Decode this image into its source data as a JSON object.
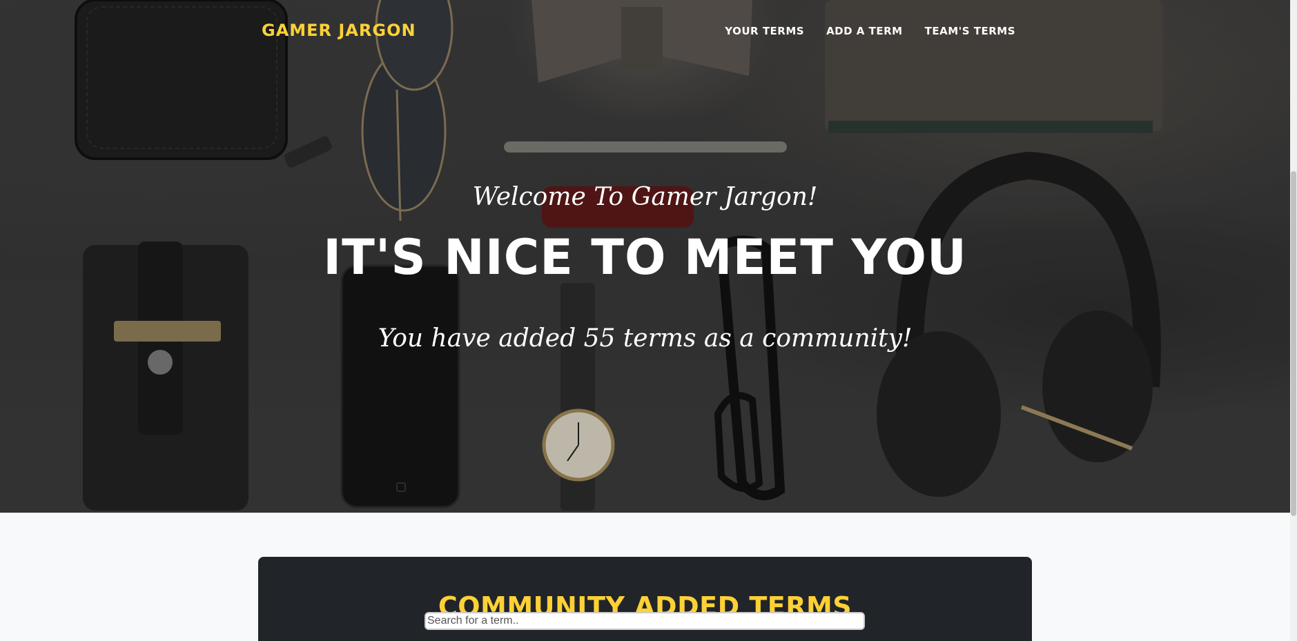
{
  "nav": {
    "brand": "GAMER JARGON",
    "links": [
      {
        "label": "YOUR TERMS"
      },
      {
        "label": "ADD A TERM"
      },
      {
        "label": "TEAM'S TERMS"
      }
    ]
  },
  "hero": {
    "lead_in": "Welcome To Gamer Jargon!",
    "heading": "IT'S NICE TO MEET YOU",
    "subtext": "You have added 55 terms as a community!"
  },
  "terms": {
    "title": "COMMUNITY ADDED TERMS",
    "search_placeholder": "Search for a term.."
  },
  "colors": {
    "accent": "#fed136",
    "panel": "#212529",
    "page_bg": "#f8f9fa"
  }
}
